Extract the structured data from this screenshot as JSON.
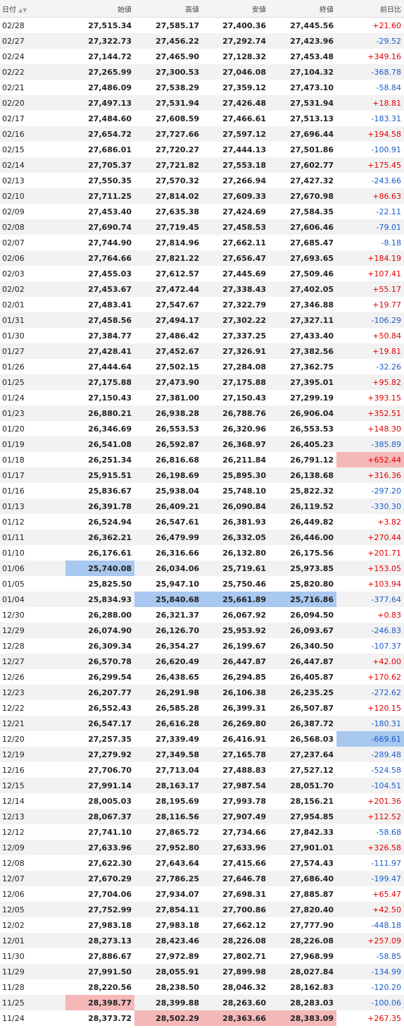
{
  "headers": {
    "date": "日付",
    "open": "始値",
    "high": "高値",
    "low": "安値",
    "close": "終値",
    "change": "前日比"
  },
  "sort_icons": {
    "asc": "▲",
    "desc": "▼"
  },
  "colors": {
    "up": "#e00000",
    "down": "#1a5cc8",
    "highlight_low": "#a8c8f0",
    "highlight_high": "#f5b8b8"
  },
  "rows": [
    [
      "02/28",
      "27,515.34",
      "27,585.17",
      "27,400.36",
      "27,445.56",
      "+21.60",
      ""
    ],
    [
      "02/27",
      "27,322.73",
      "27,456.22",
      "27,292.74",
      "27,423.96",
      "-29.52",
      ""
    ],
    [
      "02/24",
      "27,144.72",
      "27,465.90",
      "27,128.32",
      "27,453.48",
      "+349.16",
      ""
    ],
    [
      "02/22",
      "27,265.99",
      "27,300.53",
      "27,046.08",
      "27,104.32",
      "-368.78",
      ""
    ],
    [
      "02/21",
      "27,486.09",
      "27,538.29",
      "27,359.12",
      "27,473.10",
      "-58.84",
      ""
    ],
    [
      "02/20",
      "27,497.13",
      "27,531.94",
      "27,426.48",
      "27,531.94",
      "+18.81",
      ""
    ],
    [
      "02/17",
      "27,484.60",
      "27,608.59",
      "27,466.61",
      "27,513.13",
      "-183.31",
      ""
    ],
    [
      "02/16",
      "27,654.72",
      "27,727.66",
      "27,597.12",
      "27,696.44",
      "+194.58",
      ""
    ],
    [
      "02/15",
      "27,686.01",
      "27,720.27",
      "27,444.13",
      "27,501.86",
      "-100.91",
      ""
    ],
    [
      "02/14",
      "27,705.37",
      "27,721.82",
      "27,553.18",
      "27,602.77",
      "+175.45",
      ""
    ],
    [
      "02/13",
      "27,550.35",
      "27,570.32",
      "27,266.94",
      "27,427.32",
      "-243.66",
      ""
    ],
    [
      "02/10",
      "27,711.25",
      "27,814.02",
      "27,609.33",
      "27,670.98",
      "+86.63",
      ""
    ],
    [
      "02/09",
      "27,453.40",
      "27,635.38",
      "27,424.69",
      "27,584.35",
      "-22.11",
      ""
    ],
    [
      "02/08",
      "27,690.74",
      "27,719.45",
      "27,458.53",
      "27,606.46",
      "-79.01",
      ""
    ],
    [
      "02/07",
      "27,744.90",
      "27,814.96",
      "27,662.11",
      "27,685.47",
      "-8.18",
      ""
    ],
    [
      "02/06",
      "27,764.66",
      "27,821.22",
      "27,656.47",
      "27,693.65",
      "+184.19",
      ""
    ],
    [
      "02/03",
      "27,455.03",
      "27,612.57",
      "27,445.69",
      "27,509.46",
      "+107.41",
      ""
    ],
    [
      "02/02",
      "27,453.67",
      "27,472.44",
      "27,338.43",
      "27,402.05",
      "+55.17",
      ""
    ],
    [
      "02/01",
      "27,483.41",
      "27,547.67",
      "27,322.79",
      "27,346.88",
      "+19.77",
      ""
    ],
    [
      "01/31",
      "27,458.56",
      "27,494.17",
      "27,302.22",
      "27,327.11",
      "-106.29",
      ""
    ],
    [
      "01/30",
      "27,384.77",
      "27,486.42",
      "27,337.25",
      "27,433.40",
      "+50.84",
      ""
    ],
    [
      "01/27",
      "27,428.41",
      "27,452.67",
      "27,326.91",
      "27,382.56",
      "+19.81",
      ""
    ],
    [
      "01/26",
      "27,444.64",
      "27,502.15",
      "27,284.08",
      "27,362.75",
      "-32.26",
      ""
    ],
    [
      "01/25",
      "27,175.88",
      "27,473.90",
      "27,175.88",
      "27,395.01",
      "+95.82",
      ""
    ],
    [
      "01/24",
      "27,150.43",
      "27,381.00",
      "27,150.43",
      "27,299.19",
      "+393.15",
      ""
    ],
    [
      "01/23",
      "26,880.21",
      "26,938.28",
      "26,788.76",
      "26,906.04",
      "+352.51",
      ""
    ],
    [
      "01/20",
      "26,346.69",
      "26,553.53",
      "26,320.96",
      "26,553.53",
      "+148.30",
      ""
    ],
    [
      "01/19",
      "26,541.08",
      "26,592.87",
      "26,368.97",
      "26,405.23",
      "-385.89",
      ""
    ],
    [
      "01/18",
      "26,251.34",
      "26,816.68",
      "26,211.84",
      "26,791.12",
      "+652.44",
      "chg_red"
    ],
    [
      "01/17",
      "25,915.51",
      "26,198.69",
      "25,895.30",
      "26,138.68",
      "+316.36",
      ""
    ],
    [
      "01/16",
      "25,836.67",
      "25,938.04",
      "25,748.10",
      "25,822.32",
      "-297.20",
      ""
    ],
    [
      "01/13",
      "26,391.78",
      "26,409.21",
      "26,090.84",
      "26,119.52",
      "-330.30",
      ""
    ],
    [
      "01/12",
      "26,524.94",
      "26,547.61",
      "26,381.93",
      "26,449.82",
      "+3.82",
      ""
    ],
    [
      "01/11",
      "26,362.21",
      "26,479.99",
      "26,332.05",
      "26,446.00",
      "+270.44",
      ""
    ],
    [
      "01/10",
      "26,176.61",
      "26,316.66",
      "26,132.80",
      "26,175.56",
      "+201.71",
      ""
    ],
    [
      "01/06",
      "25,740.08",
      "26,034.06",
      "25,719.61",
      "25,973.85",
      "+153.05",
      "open_blue"
    ],
    [
      "01/05",
      "25,825.50",
      "25,947.10",
      "25,750.46",
      "25,820.80",
      "+103.94",
      ""
    ],
    [
      "01/04",
      "25,834.93",
      "25,840.68",
      "25,661.89",
      "25,716.86",
      "-377.64",
      "hlc_blue"
    ],
    [
      "12/30",
      "26,288.00",
      "26,321.37",
      "26,067.92",
      "26,094.50",
      "+0.83",
      ""
    ],
    [
      "12/29",
      "26,074.90",
      "26,126.70",
      "25,953.92",
      "26,093.67",
      "-246.83",
      ""
    ],
    [
      "12/28",
      "26,309.34",
      "26,354.27",
      "26,199.67",
      "26,340.50",
      "-107.37",
      ""
    ],
    [
      "12/27",
      "26,570.78",
      "26,620.49",
      "26,447.87",
      "26,447.87",
      "+42.00",
      ""
    ],
    [
      "12/26",
      "26,299.54",
      "26,438.65",
      "26,294.85",
      "26,405.87",
      "+170.62",
      ""
    ],
    [
      "12/23",
      "26,207.77",
      "26,291.98",
      "26,106.38",
      "26,235.25",
      "-272.62",
      ""
    ],
    [
      "12/22",
      "26,552.43",
      "26,585.28",
      "26,399.31",
      "26,507.87",
      "+120.15",
      ""
    ],
    [
      "12/21",
      "26,547.17",
      "26,616.28",
      "26,269.80",
      "26,387.72",
      "-180.31",
      ""
    ],
    [
      "12/20",
      "27,257.35",
      "27,339.49",
      "26,416.91",
      "26,568.03",
      "-669.61",
      "chg_blue"
    ],
    [
      "12/19",
      "27,279.92",
      "27,349.58",
      "27,165.78",
      "27,237.64",
      "-289.48",
      ""
    ],
    [
      "12/16",
      "27,706.70",
      "27,713.04",
      "27,488.83",
      "27,527.12",
      "-524.58",
      ""
    ],
    [
      "12/15",
      "27,991.14",
      "28,163.17",
      "27,987.54",
      "28,051.70",
      "-104.51",
      ""
    ],
    [
      "12/14",
      "28,005.03",
      "28,195.69",
      "27,993.78",
      "28,156.21",
      "+201.36",
      ""
    ],
    [
      "12/13",
      "28,067.37",
      "28,116.56",
      "27,907.49",
      "27,954.85",
      "+112.52",
      ""
    ],
    [
      "12/12",
      "27,741.10",
      "27,865.72",
      "27,734.66",
      "27,842.33",
      "-58.68",
      ""
    ],
    [
      "12/09",
      "27,633.96",
      "27,952.80",
      "27,633.96",
      "27,901.01",
      "+326.58",
      ""
    ],
    [
      "12/08",
      "27,622.30",
      "27,643.64",
      "27,415.66",
      "27,574.43",
      "-111.97",
      ""
    ],
    [
      "12/07",
      "27,670.29",
      "27,786.25",
      "27,646.78",
      "27,686.40",
      "-199.47",
      ""
    ],
    [
      "12/06",
      "27,704.06",
      "27,934.07",
      "27,698.31",
      "27,885.87",
      "+65.47",
      ""
    ],
    [
      "12/05",
      "27,752.99",
      "27,854.11",
      "27,700.86",
      "27,820.40",
      "+42.50",
      ""
    ],
    [
      "12/02",
      "27,983.18",
      "27,983.18",
      "27,662.12",
      "27,777.90",
      "-448.18",
      ""
    ],
    [
      "12/01",
      "28,273.13",
      "28,423.46",
      "28,226.08",
      "28,226.08",
      "+257.09",
      ""
    ],
    [
      "11/30",
      "27,886.67",
      "27,972.89",
      "27,802.71",
      "27,968.99",
      "-58.85",
      ""
    ],
    [
      "11/29",
      "27,991.50",
      "28,055.91",
      "27,899.98",
      "28,027.84",
      "-134.99",
      ""
    ],
    [
      "11/28",
      "28,220.56",
      "28,238.50",
      "28,046.32",
      "28,162.83",
      "-120.20",
      ""
    ],
    [
      "11/25",
      "28,398.77",
      "28,399.88",
      "28,263.60",
      "28,283.03",
      "-100.06",
      "open_red"
    ],
    [
      "11/24",
      "28,373.72",
      "28,502.29",
      "28,363.66",
      "28,383.09",
      "+267.35",
      "hlc_red"
    ]
  ]
}
